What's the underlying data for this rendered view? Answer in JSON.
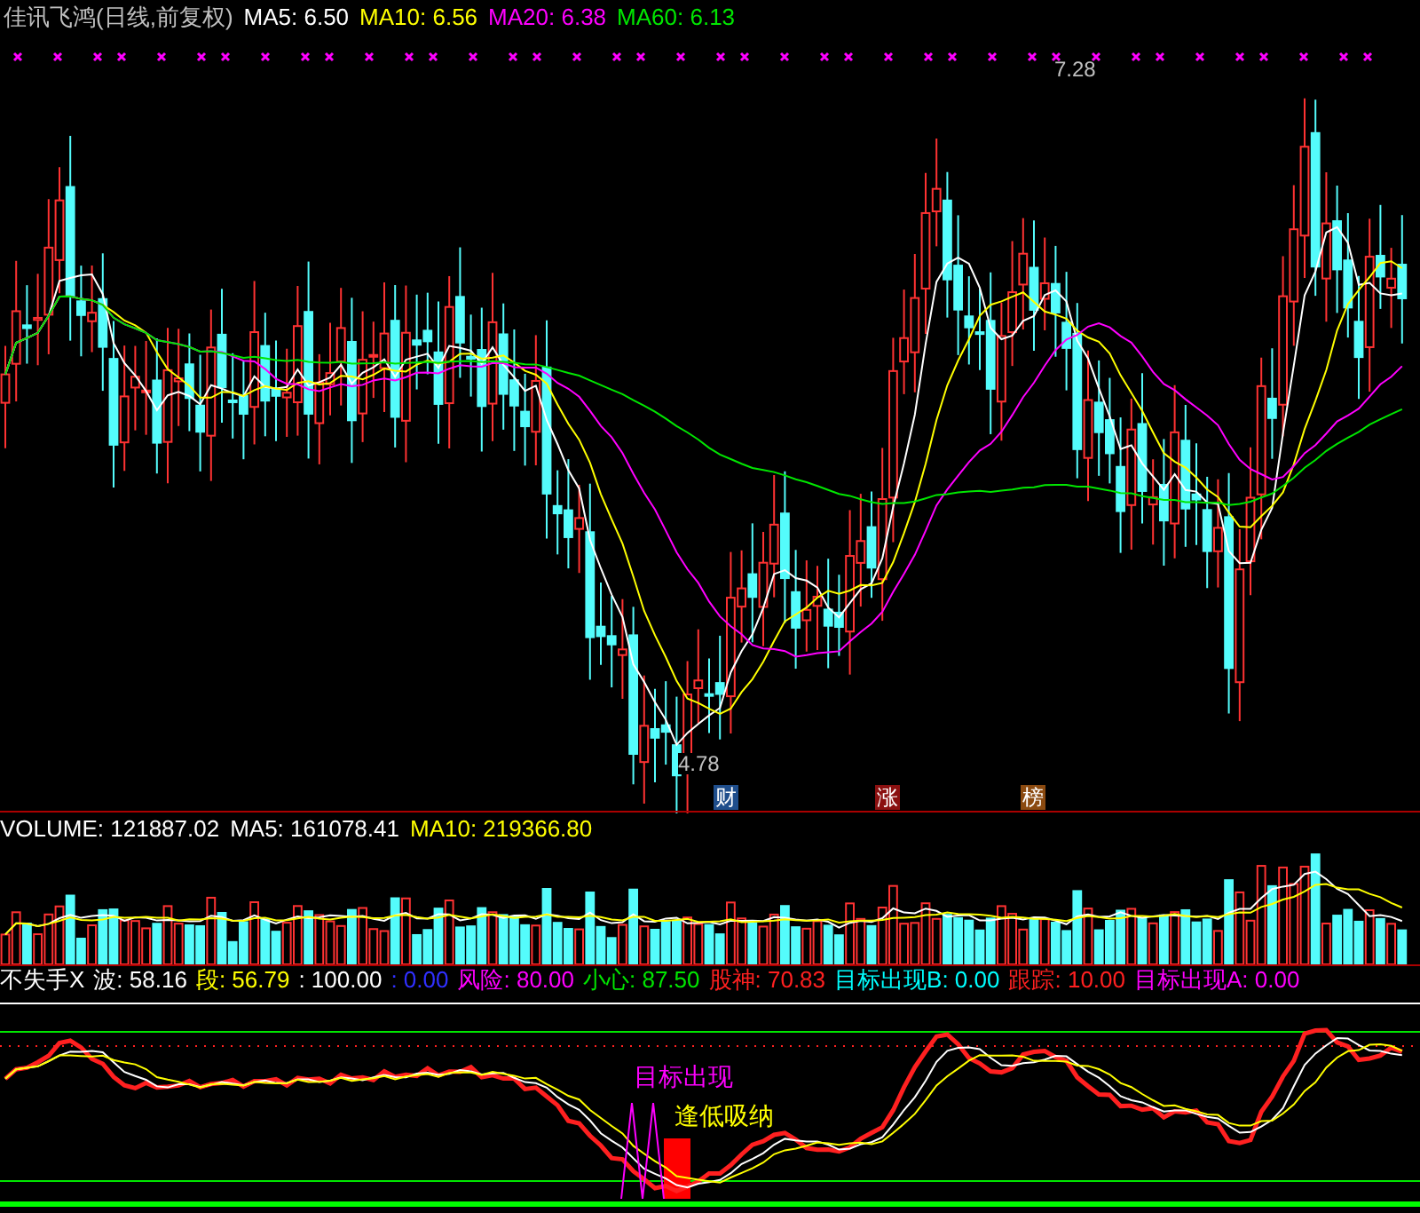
{
  "title": {
    "name": "佳讯飞鸿(日线,前复权)",
    "items": [
      {
        "label": "MA5: 6.50",
        "color": "#ffffff"
      },
      {
        "label": "MA10: 6.56",
        "color": "#ffff00"
      },
      {
        "label": "MA20: 6.38",
        "color": "#ff00ff"
      },
      {
        "label": "MA60: 6.13",
        "color": "#00e600"
      }
    ]
  },
  "high_label": "7.28",
  "low_label": "4.78",
  "event_tags": [
    {
      "text": "财",
      "color": "#1f4e8c"
    },
    {
      "text": "涨",
      "color": "#8b1010"
    },
    {
      "text": "榜",
      "color": "#8b4a10"
    }
  ],
  "volume": {
    "items": [
      {
        "label": "VOLUME: 121887.02",
        "color": "#ffffff"
      },
      {
        "label": "MA5: 161078.41",
        "color": "#ffffff"
      },
      {
        "label": "MA10: 219366.80",
        "color": "#ffff00"
      }
    ]
  },
  "indicator": {
    "items": [
      {
        "label": "不失手X",
        "color": "#ffffff"
      },
      {
        "label": "波: 58.16",
        "color": "#ffffff"
      },
      {
        "label": "段: 56.79",
        "color": "#ffff00"
      },
      {
        "label": ": 100.00",
        "color": "#ffffff"
      },
      {
        "label": ": 0.00",
        "color": "#3030ff"
      },
      {
        "label": "风险: 80.00",
        "color": "#ff00ff"
      },
      {
        "label": "小心: 87.50",
        "color": "#00e600"
      },
      {
        "label": "股神: 70.83",
        "color": "#ff2020"
      },
      {
        "label": "目标出现B: 0.00",
        "color": "#00ffff"
      },
      {
        "label": "跟踪: 10.00",
        "color": "#ff2020"
      },
      {
        "label": "目标出现A: 0.00",
        "color": "#ff00ff"
      }
    ],
    "annotations": [
      {
        "text": "目标出现",
        "color": "#ff00ff"
      },
      {
        "text": "逢低吸纳",
        "color": "#ffff00"
      }
    ]
  }
}
